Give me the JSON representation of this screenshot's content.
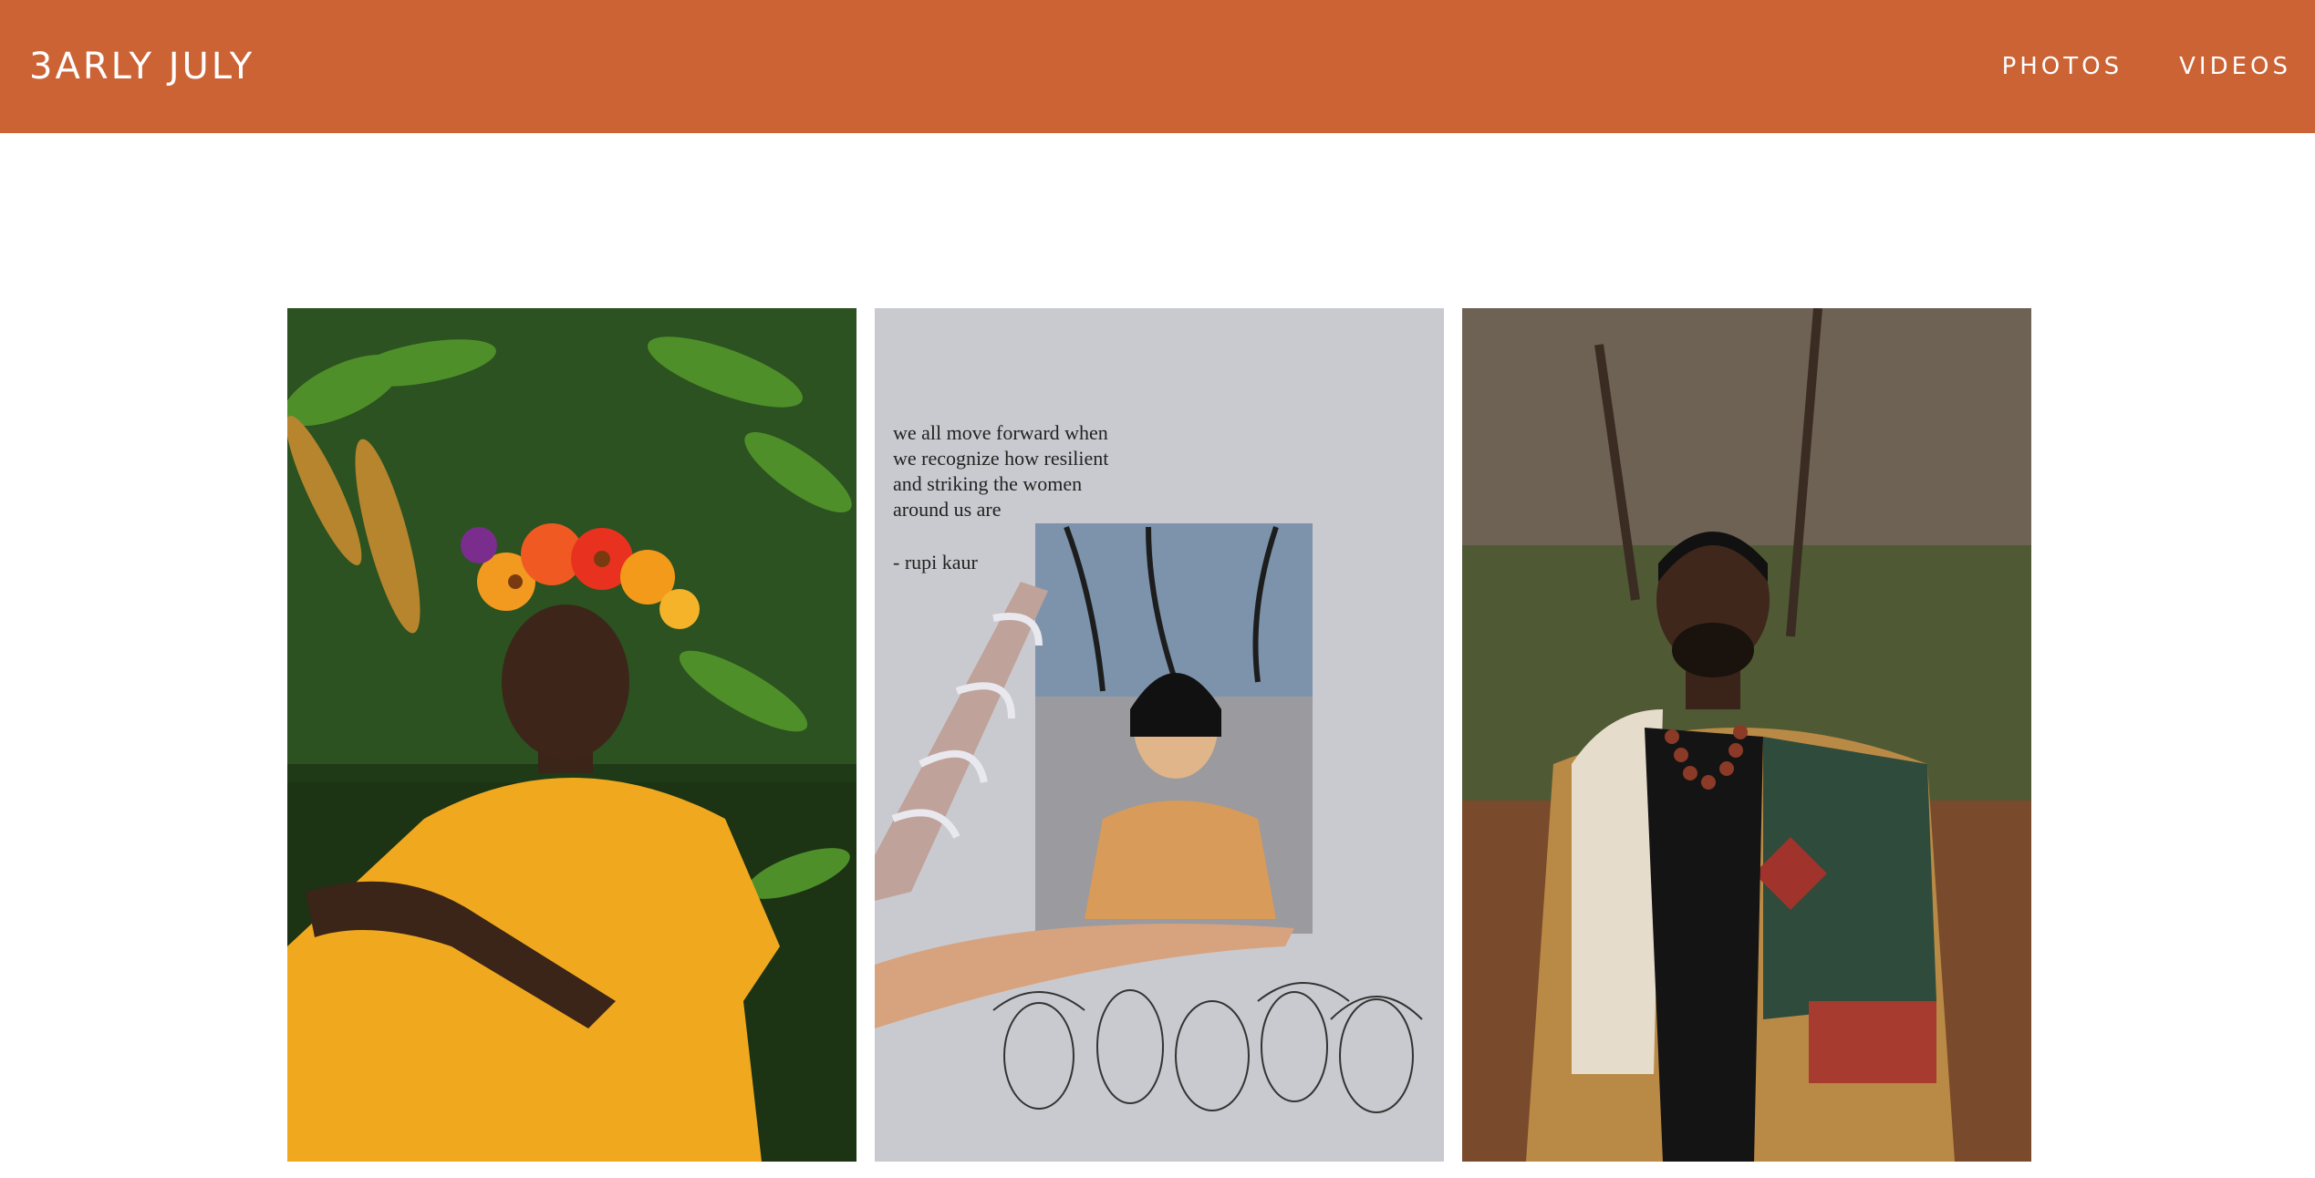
{
  "header": {
    "logo": "3ARLY JULY",
    "nav": [
      {
        "label": "PHOTOS"
      },
      {
        "label": "VIDEOS"
      }
    ]
  },
  "colors": {
    "brand": "#cc6335",
    "background": "#ffffff"
  },
  "gallery": {
    "photos": [
      {
        "subject": "portrait-flower-crown-yellow-dress"
      },
      {
        "subject": "portrait-mirror-poem-collage",
        "poem": {
          "lines": [
            "we all move forward when",
            "we recognize how resilient",
            "and striking the women",
            "around us are"
          ],
          "attribution": "- rupi kaur"
        }
      },
      {
        "subject": "portrait-man-patchwork-jacket"
      }
    ]
  }
}
